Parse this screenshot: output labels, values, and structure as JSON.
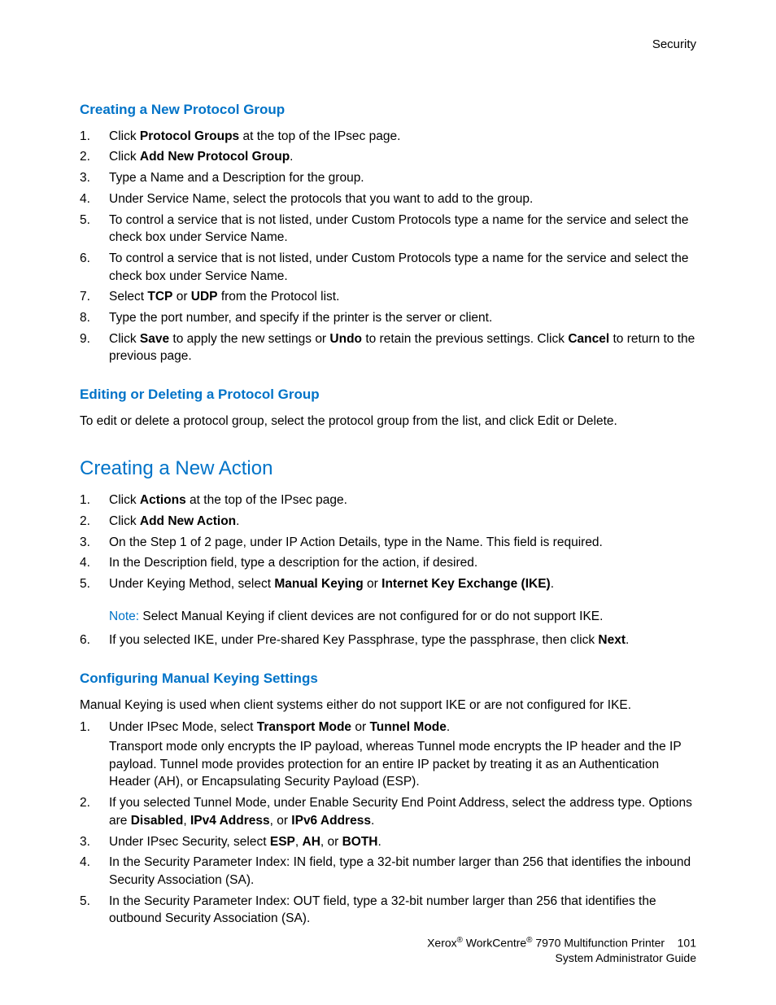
{
  "header": {
    "section": "Security"
  },
  "s1": {
    "title": "Creating a New Protocol Group",
    "items": [
      {
        "n": "1.",
        "parts": [
          [
            "",
            "Click "
          ],
          [
            "b",
            "Protocol Groups"
          ],
          [
            "",
            " at the top of the IPsec page."
          ]
        ]
      },
      {
        "n": "2.",
        "parts": [
          [
            "",
            "Click "
          ],
          [
            "b",
            "Add New Protocol Group"
          ],
          [
            "",
            "."
          ]
        ]
      },
      {
        "n": "3.",
        "parts": [
          [
            "",
            "Type a Name and a Description for the group."
          ]
        ]
      },
      {
        "n": "4.",
        "parts": [
          [
            "",
            "Under Service Name, select the protocols that you want to add to the group."
          ]
        ]
      },
      {
        "n": "5.",
        "parts": [
          [
            "",
            "To control a service that is not listed, under Custom Protocols type a name for the service and select the check box under Service Name."
          ]
        ]
      },
      {
        "n": "6.",
        "parts": [
          [
            "",
            "To control a service that is not listed, under Custom Protocols type a name for the service and select the check box under Service Name."
          ]
        ]
      },
      {
        "n": "7.",
        "parts": [
          [
            "",
            "Select "
          ],
          [
            "b",
            "TCP"
          ],
          [
            "",
            " or "
          ],
          [
            "b",
            "UDP"
          ],
          [
            "",
            " from the Protocol list."
          ]
        ]
      },
      {
        "n": "8.",
        "parts": [
          [
            "",
            "Type the port number, and specify if the printer is the server or client."
          ]
        ]
      },
      {
        "n": "9.",
        "parts": [
          [
            "",
            "Click "
          ],
          [
            "b",
            "Save"
          ],
          [
            "",
            " to apply the new settings or "
          ],
          [
            "b",
            "Undo"
          ],
          [
            "",
            " to retain the previous settings. Click "
          ],
          [
            "b",
            "Cancel"
          ],
          [
            "",
            " to return to the previous page."
          ]
        ]
      }
    ]
  },
  "s2": {
    "title": "Editing or Deleting a Protocol Group",
    "para": "To edit or delete a protocol group, select the protocol group from the list, and click Edit or Delete."
  },
  "s3": {
    "title": "Creating a New Action",
    "items": [
      {
        "n": "1.",
        "parts": [
          [
            "",
            "Click "
          ],
          [
            "b",
            "Actions"
          ],
          [
            "",
            " at the top of the IPsec page."
          ]
        ]
      },
      {
        "n": "2.",
        "parts": [
          [
            "",
            "Click "
          ],
          [
            "b",
            "Add New Action"
          ],
          [
            "",
            "."
          ]
        ]
      },
      {
        "n": "3.",
        "parts": [
          [
            "",
            "On the Step 1 of 2 page, under IP Action Details, type in the Name. This field is required."
          ]
        ]
      },
      {
        "n": "4.",
        "parts": [
          [
            "",
            "In the Description field, type a description for the action, if desired."
          ]
        ]
      },
      {
        "n": "5.",
        "parts": [
          [
            "",
            "Under Keying Method, select "
          ],
          [
            "b",
            "Manual Keying"
          ],
          [
            "",
            " or "
          ],
          [
            "b",
            "Internet Key Exchange (IKE)"
          ],
          [
            "",
            "."
          ]
        ]
      }
    ],
    "noteLabel": "Note:",
    "noteText": " Select Manual Keying if client devices are not configured for or do not support IKE.",
    "items2": [
      {
        "n": "6.",
        "parts": [
          [
            "",
            "If you selected IKE, under Pre-shared Key Passphrase, type the passphrase, then click "
          ],
          [
            "b",
            "Next"
          ],
          [
            "",
            "."
          ]
        ]
      }
    ]
  },
  "s4": {
    "title": "Configuring Manual Keying Settings",
    "para": "Manual Keying is used when client systems either do not support IKE or are not configured for IKE.",
    "items": [
      {
        "n": "1.",
        "parts": [
          [
            "",
            "Under IPsec Mode, select "
          ],
          [
            "b",
            "Transport Mode"
          ],
          [
            "",
            " or "
          ],
          [
            "b",
            "Tunnel Mode"
          ],
          [
            "",
            "."
          ]
        ],
        "sub": "Transport mode only encrypts the IP payload, whereas Tunnel mode encrypts the IP header and the IP payload. Tunnel mode provides protection for an entire IP packet by treating it as an Authentication Header (AH), or Encapsulating Security Payload (ESP)."
      },
      {
        "n": "2.",
        "parts": [
          [
            "",
            "If you selected Tunnel Mode, under Enable Security End Point Address, select the address type. Options are "
          ],
          [
            "b",
            "Disabled"
          ],
          [
            "",
            ", "
          ],
          [
            "b",
            "IPv4 Address"
          ],
          [
            "",
            ", or "
          ],
          [
            "b",
            "IPv6 Address"
          ],
          [
            "",
            "."
          ]
        ]
      },
      {
        "n": "3.",
        "parts": [
          [
            "",
            "Under IPsec Security, select "
          ],
          [
            "b",
            "ESP"
          ],
          [
            "",
            ", "
          ],
          [
            "b",
            "AH"
          ],
          [
            "",
            ", or "
          ],
          [
            "b",
            "BOTH"
          ],
          [
            "",
            "."
          ]
        ]
      },
      {
        "n": "4.",
        "parts": [
          [
            "",
            "In the Security Parameter Index: IN field, type a 32-bit number larger than 256 that identifies the inbound Security Association (SA)."
          ]
        ]
      },
      {
        "n": "5.",
        "parts": [
          [
            "",
            "In the Security Parameter Index: OUT field, type a 32-bit number larger than 256 that identifies the outbound Security Association (SA)."
          ]
        ]
      }
    ]
  },
  "footer": {
    "line1_a": "Xerox",
    "line1_b": " WorkCentre",
    "line1_c": " 7970 Multifunction Printer",
    "pageNum": "101",
    "line2": "System Administrator Guide"
  }
}
